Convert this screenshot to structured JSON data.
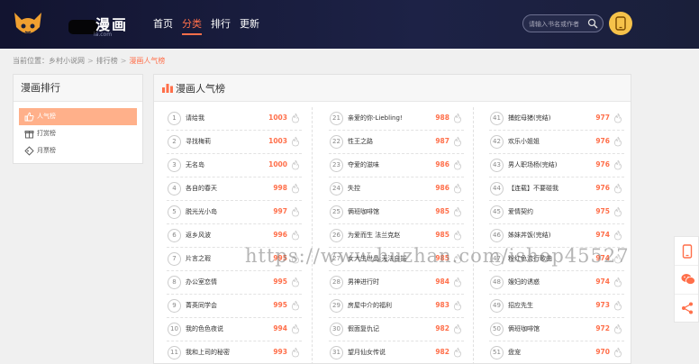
{
  "header": {
    "logo_title": "漫画",
    "logo_sub": "ia.com",
    "nav": [
      {
        "label": "首页",
        "active": false
      },
      {
        "label": "分类",
        "active": true
      },
      {
        "label": "排行",
        "active": false
      },
      {
        "label": "更新",
        "active": false
      }
    ],
    "search_placeholder": "请输入书名或作者"
  },
  "breadcrumb": {
    "prefix": "当前位置：",
    "items": [
      "乡村小说网",
      "排行榜",
      "漫画人气榜"
    ],
    "sep": ">"
  },
  "sidebar": {
    "title": "漫画排行",
    "items": [
      {
        "label": "人气榜",
        "icon": "thumb-icon",
        "active": true
      },
      {
        "label": "打赏榜",
        "icon": "gift-icon",
        "active": false
      },
      {
        "label": "月票榜",
        "icon": "ticket-icon",
        "active": false
      }
    ]
  },
  "ranking": {
    "title": "漫画人气榜",
    "columns": [
      [
        {
          "rank": "1",
          "name": "请给我",
          "score": "1003"
        },
        {
          "rank": "2",
          "name": "寻找梅莉",
          "score": "1003"
        },
        {
          "rank": "3",
          "name": "无名岛",
          "score": "1000"
        },
        {
          "rank": "4",
          "name": "各自的春天",
          "score": "998"
        },
        {
          "rank": "5",
          "name": "脱光光小岛",
          "score": "997"
        },
        {
          "rank": "6",
          "name": "返乡风波",
          "score": "996"
        },
        {
          "rank": "7",
          "name": "片言之瑕",
          "score": "995"
        },
        {
          "rank": "8",
          "name": "办公室恋情",
          "score": "995"
        },
        {
          "rank": "9",
          "name": "菁英同学会",
          "score": "995"
        },
        {
          "rank": "10",
          "name": "我的色色夜说",
          "score": "994"
        },
        {
          "rank": "11",
          "name": "我和上司的秘密",
          "score": "993"
        }
      ],
      [
        {
          "rank": "21",
          "name": "亲爱的你-Liebling!",
          "score": "988"
        },
        {
          "rank": "22",
          "name": "性王之路",
          "score": "987"
        },
        {
          "rank": "23",
          "name": "夺爱的滋味",
          "score": "986"
        },
        {
          "rank": "24",
          "name": "失控",
          "score": "986"
        },
        {
          "rank": "25",
          "name": "俩班咖啡馆",
          "score": "985"
        },
        {
          "rank": "26",
          "name": "为爱而生 法兰克赵",
          "score": "985"
        },
        {
          "rank": "27",
          "name": "女大生世晶:无法自拔",
          "score": "985"
        },
        {
          "rank": "28",
          "name": "男神进行时",
          "score": "984"
        },
        {
          "rank": "29",
          "name": "房屋中介的福利",
          "score": "983"
        },
        {
          "rank": "30",
          "name": "假面复仇记",
          "score": "982"
        },
        {
          "rank": "31",
          "name": "望月仙女传说",
          "score": "982"
        }
      ],
      [
        {
          "rank": "41",
          "name": "捕蛇母猪(完结)",
          "score": "977"
        },
        {
          "rank": "42",
          "name": "欢乐小姐姐",
          "score": "976"
        },
        {
          "rank": "43",
          "name": "男人职场杨(完结)",
          "score": "976"
        },
        {
          "rank": "44",
          "name": "【连载】不要碰我",
          "score": "976"
        },
        {
          "rank": "45",
          "name": "爱情契约",
          "score": "975"
        },
        {
          "rank": "46",
          "name": "姊妹丼饭(完结)",
          "score": "974"
        },
        {
          "rank": "47",
          "name": "粉红色流行歌曲",
          "score": "974"
        },
        {
          "rank": "48",
          "name": "嫂妇的诱惑",
          "score": "974"
        },
        {
          "rank": "49",
          "name": "招应先生",
          "score": "973"
        },
        {
          "rank": "50",
          "name": "俩班咖啡馆",
          "score": "972"
        },
        {
          "rank": "51",
          "name": "盘宠",
          "score": "970"
        }
      ]
    ]
  },
  "watermark": "https://www.huzhan.com/ishop45527",
  "colors": {
    "accent": "#ff6f4a",
    "header_bg": "#1a1f3a",
    "sidebar_active": "#ffb08a"
  },
  "floatbar": [
    "phone-icon",
    "wechat-icon",
    "share-icon"
  ]
}
